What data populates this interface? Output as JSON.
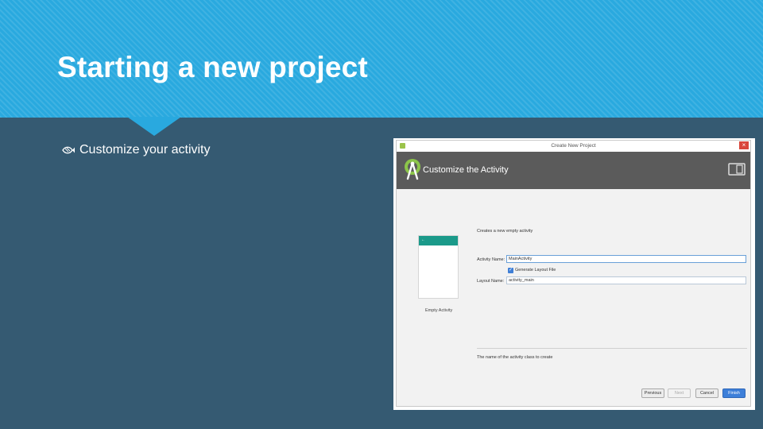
{
  "slide": {
    "title": "Starting a new project",
    "bullet": "Customize your activity"
  },
  "dialog": {
    "window_title": "Create New Project",
    "banner_title": "Customize the Activity",
    "description": "Creates a new empty activity",
    "activity_name_label": "Activity Name:",
    "activity_name_value": "MainActivity",
    "generate_layout_label": "Generate Layout File",
    "generate_layout_checked": true,
    "layout_name_label": "Layout Name:",
    "layout_name_value": "activity_main",
    "preview_caption": "Empty Activity",
    "hint": "The name of the activity class to create",
    "buttons": {
      "previous": "Previous",
      "next": "Next",
      "cancel": "Cancel",
      "finish": "Finish"
    }
  },
  "colors": {
    "header": "#29a9df",
    "background": "#355a72",
    "banner": "#5b5b5b",
    "accent": "#3d7fd9",
    "preview_bar": "#1b9a8a"
  },
  "icons": [
    "bullet-fish-icon",
    "android-studio-logo-icon",
    "device-layout-icon",
    "close-icon",
    "checkbox-checked-icon"
  ]
}
